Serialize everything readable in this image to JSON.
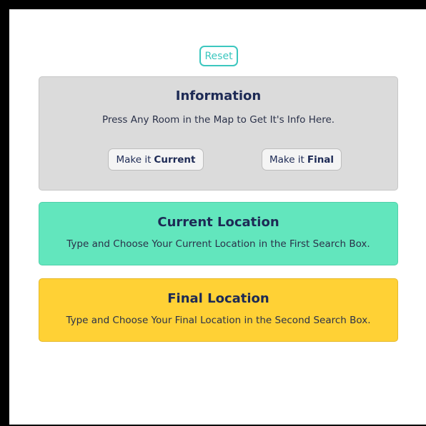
{
  "reset": {
    "label": "Reset"
  },
  "info": {
    "title": "Information",
    "text": "Press Any Room in the Map to Get It's Info Here.",
    "make_current": {
      "prefix": "Make it",
      "bold": "Current"
    },
    "make_final": {
      "prefix": "Make it",
      "bold": "Final"
    }
  },
  "current_location": {
    "title": "Current Location",
    "text": "Type and Choose Your Current Location in the First Search Box."
  },
  "final_location": {
    "title": "Final Location",
    "text": "Type and Choose Your Final Location in the Second Search Box."
  },
  "colors": {
    "reset_accent": "#3cc7bf",
    "info_bg": "#dbdbdb",
    "current_bg": "#62e6bd",
    "final_bg": "#ffd135",
    "title_text": "#1d2a55"
  }
}
